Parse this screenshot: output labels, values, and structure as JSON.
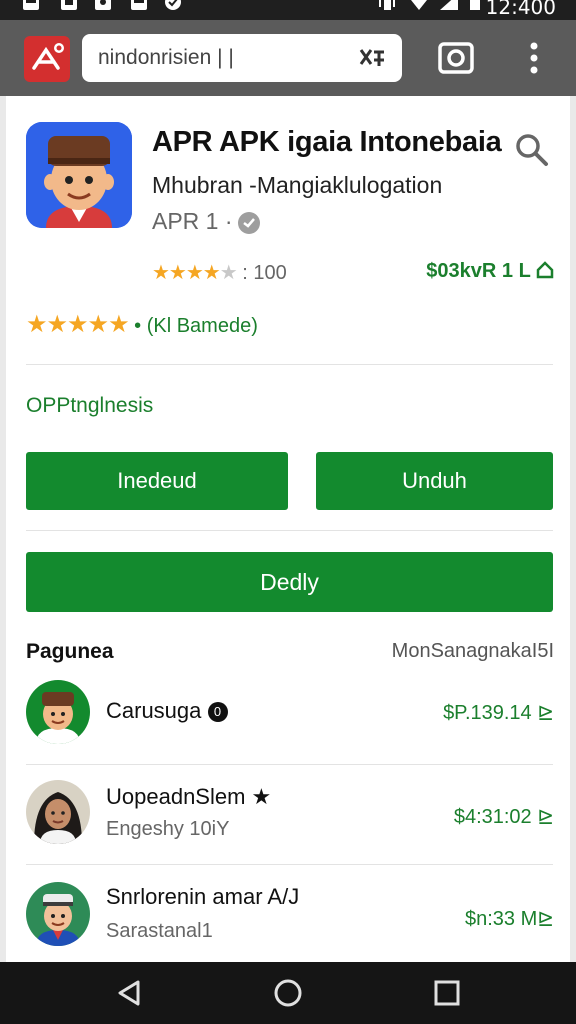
{
  "status_bar": {
    "time": "12:400",
    "icons": [
      "notification-icon",
      "notification-icon",
      "notification-icon",
      "notification-icon",
      "check-circle-icon",
      "vibrate-icon",
      "wifi-icon",
      "signal-icon",
      "battery-icon"
    ]
  },
  "browser": {
    "url": "nindonrisien | |",
    "actions": [
      "app-logo-icon",
      "translate-icon",
      "tab-switcher-icon",
      "more-vert-icon"
    ]
  },
  "app": {
    "title": "APR APK igaia Intonebaia",
    "subtitle": "Mhubran -Mangiaklulogation",
    "developer": "APR 1 ·",
    "rating_text": ": 100",
    "rating_stars": 4,
    "price": "$03kvR 1 L",
    "review_stars": "★★★★★",
    "reviews": "• (Kl Bamede)",
    "section_label": "OPPtnglnesis"
  },
  "buttons": {
    "install": "Inedeud",
    "download": "Unduh",
    "deploy": "Dedly"
  },
  "list": {
    "title": "Pagunea",
    "right_label": "MonSanagnakaI5I",
    "rows": [
      {
        "name": "Carusuga",
        "badge": "0",
        "subtitle": "",
        "price": "$P.139.14 ⊵"
      },
      {
        "name": "UopeadnSlem ★",
        "badge": "",
        "subtitle": "Engeshy 10iY",
        "price": "$4:31:02 ⊵"
      },
      {
        "name": "Snrlorenin amar A/J",
        "badge": "",
        "subtitle": "Sarastanal1",
        "price": "$n:33 M⊵"
      }
    ]
  },
  "colors": {
    "accent_green": "#138a2e",
    "price_green": "#1b7f2d",
    "star_gold": "#f5a623",
    "browser_red": "#d32f2f",
    "app_icon_blue": "#2f62e8"
  },
  "navbar": {
    "buttons": [
      "back-icon",
      "home-icon",
      "recents-icon"
    ]
  }
}
